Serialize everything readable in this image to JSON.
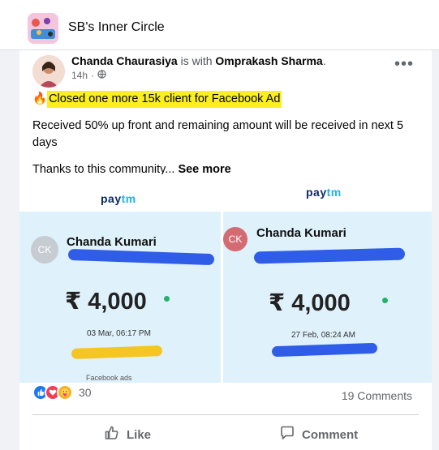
{
  "group": {
    "name": "SB's Inner Circle",
    "thumbnail_icon": "group-cover-icon"
  },
  "post": {
    "author": "Chanda Chaurasiya",
    "with_text": "is with",
    "tagged": "Omprakash Sharma",
    "tagged_suffix": ".",
    "time": "14h",
    "time_separator": "·",
    "privacy_icon": "globe-icon",
    "more_label": "•••",
    "headline_emoji": "🔥",
    "headline": "Closed one more 15k client for Facebook Ad",
    "body": "Received 50% up front and remaining amount will be received in next 5 days",
    "thanks": "Thanks to this community...",
    "see_more": "See more"
  },
  "receipts": [
    {
      "brand_pay": "pay",
      "brand_tm": "tm",
      "initials": "CK",
      "payee": "Chanda Kumari",
      "amount": "₹ 4,000",
      "datetime": "03 Mar, 06:17 PM",
      "footer": "Facebook ads"
    },
    {
      "brand_pay": "pay",
      "brand_tm": "tm",
      "initials": "CK",
      "payee": "Chanda Kumari",
      "amount": "₹ 4,000",
      "datetime": "27 Feb, 08:24 AM"
    }
  ],
  "reactions": {
    "count": "30",
    "types": [
      "like",
      "love",
      "care"
    ],
    "comments": "19 Comments"
  },
  "actions": {
    "like": "Like",
    "comment": "Comment"
  },
  "colors": {
    "highlight": "#fbee22",
    "paytm_dark": "#0d2a66",
    "paytm_light": "#1fb3e8",
    "like_blue": "#1877f2",
    "love_red": "#f33e58",
    "care_yellow": "#f7b125"
  }
}
